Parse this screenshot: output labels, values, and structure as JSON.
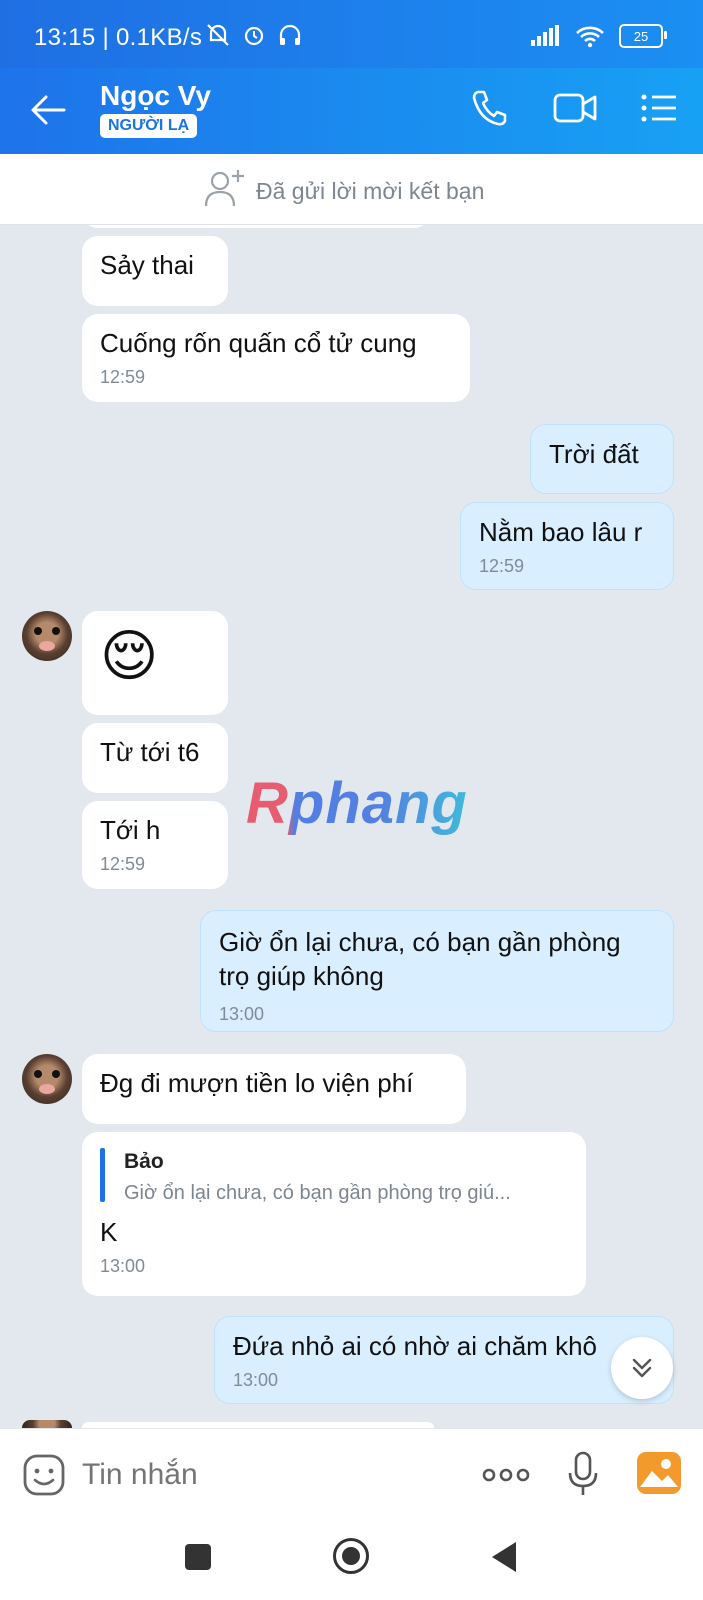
{
  "status_bar": {
    "time_speed": "13:15 | 0.1KB/s",
    "battery": "25"
  },
  "header": {
    "name": "Ngọc Vy",
    "badge": "NGƯỜI LẠ"
  },
  "friend_request": {
    "text": "Đã gửi lời mời kết bạn"
  },
  "messages": {
    "m1": "Sảy thai",
    "m2": {
      "text": "Cuống rốn quấn cổ tử cung",
      "time": "12:59"
    },
    "m3": "Trời đất",
    "m4": {
      "text": "Nằm bao lâu r",
      "time": "12:59"
    },
    "m5_emoji": "😌",
    "m6": "Từ tới t6",
    "m7": {
      "text": "Tới h",
      "time": "12:59"
    },
    "m8": {
      "text": "Giờ ổn lại chưa, có bạn gần phòng trọ giúp không",
      "time": "13:00"
    },
    "m9": "Đg đi mượn tiền lo viện phí",
    "m10": {
      "quote_author": "Bảo",
      "quote_text": "Giờ ổn lại chưa, có bạn gần phòng trọ giú...",
      "text": "K",
      "time": "13:00"
    },
    "m11": {
      "text": "Đứa nhỏ ai có nhờ ai chăm khô",
      "time": "13:00"
    }
  },
  "watermark": "Rphang",
  "input": {
    "placeholder": "Tin nhắn"
  },
  "colors": {
    "header_start": "#1e73ea",
    "header_end": "#17a1f4",
    "my_bubble": "#d9efff",
    "background": "#e2e8ee"
  },
  "icons": [
    "back-arrow-icon",
    "phone-icon",
    "video-call-icon",
    "menu-icon",
    "add-friend-icon",
    "sticker-icon",
    "more-icon",
    "microphone-icon",
    "gallery-icon",
    "scroll-down-icon"
  ]
}
